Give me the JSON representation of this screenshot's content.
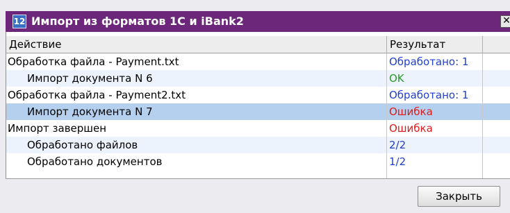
{
  "window": {
    "title": "Импорт из форматов 1С и iBank2",
    "icon_label": "12",
    "close_label": "✕"
  },
  "table": {
    "columns": [
      "Действие",
      "Результат"
    ],
    "rows": [
      {
        "action": "Обработка файла - Payment.txt",
        "result": "Обработано: 1",
        "indent": 0,
        "result_color": "#1f3fd0",
        "selected": false
      },
      {
        "action": "Импорт документа N 6",
        "result": "OK",
        "indent": 1,
        "result_color": "#2a9a2a",
        "selected": false
      },
      {
        "action": "Обработка файла - Payment2.txt",
        "result": "Обработано: 1",
        "indent": 0,
        "result_color": "#1f3fd0",
        "selected": false
      },
      {
        "action": "Импорт документа N 7",
        "result": "Ошибка",
        "indent": 1,
        "result_color": "#e01a1a",
        "selected": true
      },
      {
        "action": "Импорт завершен",
        "result": "Ошибка",
        "indent": 0,
        "result_color": "#e01a1a",
        "selected": false
      },
      {
        "action": "Обработано файлов",
        "result": "2/2",
        "indent": 1,
        "result_color": "#1f3fd0",
        "selected": false
      },
      {
        "action": "Обработано документов",
        "result": "1/2",
        "indent": 1,
        "result_color": "#1f3fd0",
        "selected": false
      }
    ]
  },
  "footer": {
    "close_button_label": "Закрыть"
  },
  "colors": {
    "titlebar": "#6c267a",
    "selected_row": "#b4d0ee",
    "alt_row": "#edf3fc",
    "ok": "#2a9a2a",
    "error": "#e01a1a",
    "info": "#1f3fd0"
  }
}
